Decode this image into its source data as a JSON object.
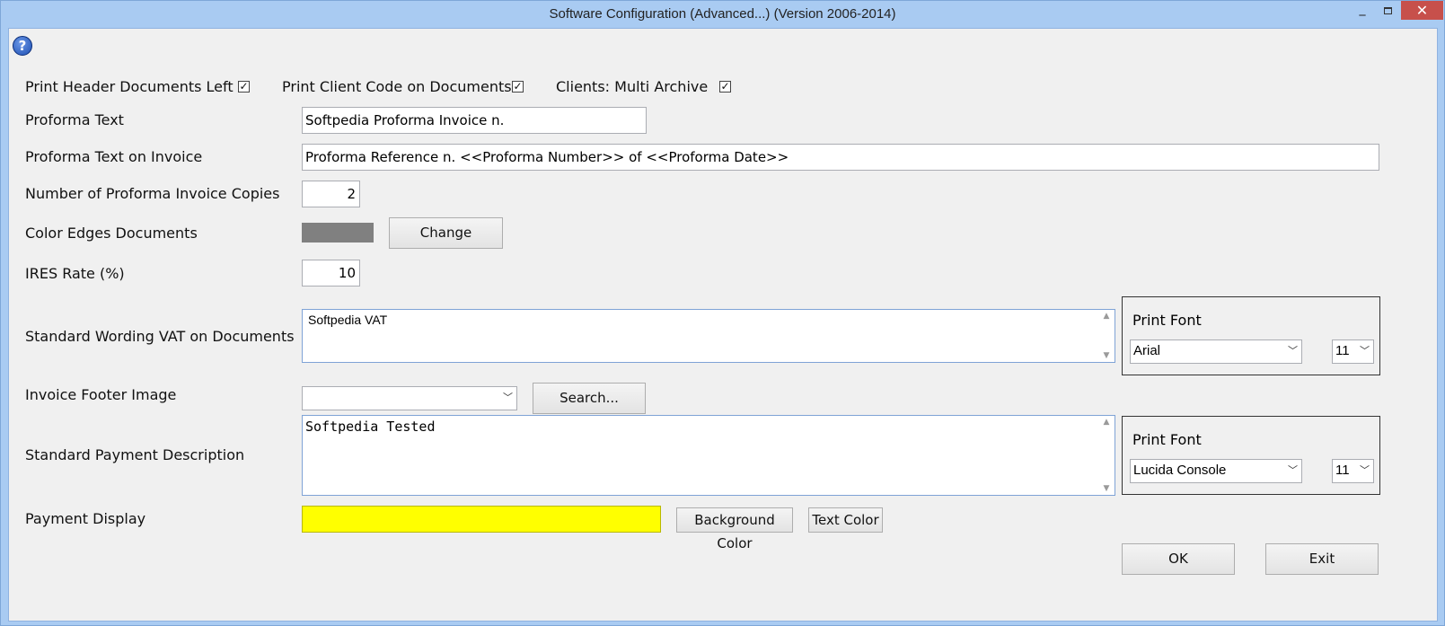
{
  "window": {
    "title": "Software Configuration (Advanced...) (Version 2006-2014)",
    "minimize_glyph": "_",
    "close_glyph": "✕"
  },
  "help": {
    "glyph": "?"
  },
  "checkboxes": [
    {
      "label": "Print Header Documents Left",
      "checked": true
    },
    {
      "label": "Print Client Code on Documents",
      "checked": true
    },
    {
      "label": "Clients: Multi Archive",
      "checked": true
    }
  ],
  "check_glyph": "✓",
  "fields": {
    "proforma_text": {
      "label": "Proforma Text",
      "value": "Softpedia Proforma Invoice n."
    },
    "proforma_text_invoice": {
      "label": "Proforma Text on Invoice",
      "value": "Proforma Reference n. <<Proforma Number>> of <<Proforma Date>>"
    },
    "copies": {
      "label": "Number of Proforma Invoice Copies",
      "value": "2"
    },
    "color_edges": {
      "label": "Color Edges Documents",
      "color": "#808080",
      "button": "Change"
    },
    "ires_rate": {
      "label": "IRES Rate (%)",
      "value": "10"
    },
    "vat_wording": {
      "label": "Standard Wording VAT on Documents",
      "value": "Softpedia VAT",
      "print_font_label": "Print Font",
      "font": "Arial",
      "size": "11"
    },
    "footer_image": {
      "label": "Invoice Footer Image",
      "value": "",
      "button": "Search..."
    },
    "payment_description": {
      "label": "Standard Payment Description",
      "value": "Softpedia Tested",
      "print_font_label": "Print Font",
      "font": "Lucida Console",
      "size": "11"
    },
    "payment_display": {
      "label": "Payment Display",
      "color": "#ffff00",
      "background_button": "Background Color",
      "text_button": "Text Color"
    }
  },
  "actions": {
    "ok": "OK",
    "exit": "Exit"
  },
  "colors": {
    "titlebar": "#a9cbf2",
    "close": "#c7504b",
    "client": "#f0f0f0"
  }
}
